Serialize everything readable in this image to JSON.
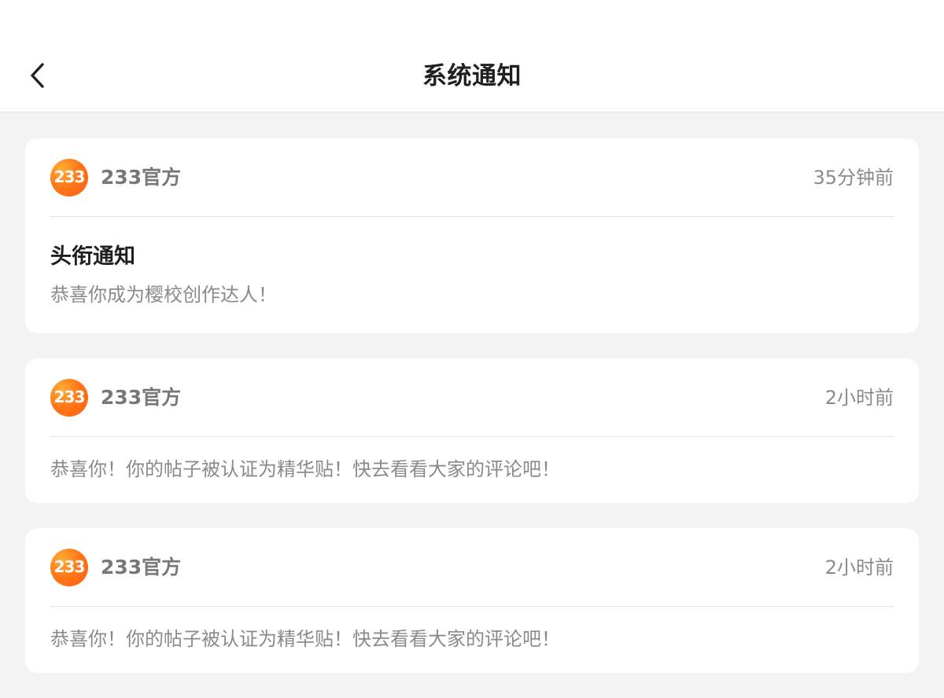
{
  "header": {
    "back_icon": "back-arrow-icon",
    "title": "系统通知"
  },
  "notifications": [
    {
      "avatar_text": "233",
      "sender": "233官方",
      "time": "35分钟前",
      "title": "头衔通知",
      "message": "恭喜你成为樱校创作达人！"
    },
    {
      "avatar_text": "233",
      "sender": "233官方",
      "time": "2小时前",
      "message": "恭喜你！你的帖子被认证为精华贴！快去看看大家的评论吧！"
    },
    {
      "avatar_text": "233",
      "sender": "233官方",
      "time": "2小时前",
      "message": "恭喜你！你的帖子被认证为精华贴！快去看看大家的评论吧！"
    }
  ],
  "colors": {
    "background": "#f4f4f4",
    "card": "#ffffff",
    "accent": "#ff7a1a",
    "title": "#1f1f1f",
    "secondary_text": "#8a8a8a"
  }
}
